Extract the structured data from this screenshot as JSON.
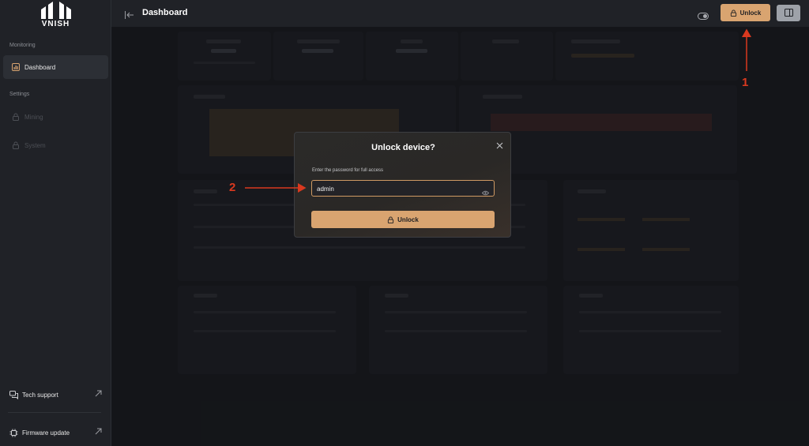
{
  "app": {
    "brand": "VNISH"
  },
  "sidebar": {
    "sections": [
      {
        "label": "Monitoring"
      },
      {
        "label": "Settings"
      }
    ],
    "items": [
      {
        "label": "Dashboard",
        "icon": "chart-icon",
        "active": true
      },
      {
        "label": "Mining",
        "icon": "lock-icon",
        "locked": true
      },
      {
        "label": "System",
        "icon": "lock-icon",
        "locked": true
      }
    ],
    "bottom": [
      {
        "label": "Tech support",
        "icon": "chat-icon"
      },
      {
        "label": "Firmware update",
        "icon": "chip-icon"
      }
    ]
  },
  "header": {
    "title": "Dashboard",
    "unlock_label": "Unlock"
  },
  "modal": {
    "title": "Unlock device?",
    "field_label": "Enter the password for full access",
    "password_value": "admin",
    "submit_label": "Unlock"
  },
  "annotations": [
    {
      "label": "1",
      "color": "#d9391f"
    },
    {
      "label": "2",
      "color": "#d9391f"
    }
  ],
  "colors": {
    "accent": "#d9a470",
    "background": "#1f2126",
    "annotation": "#d9391f"
  }
}
